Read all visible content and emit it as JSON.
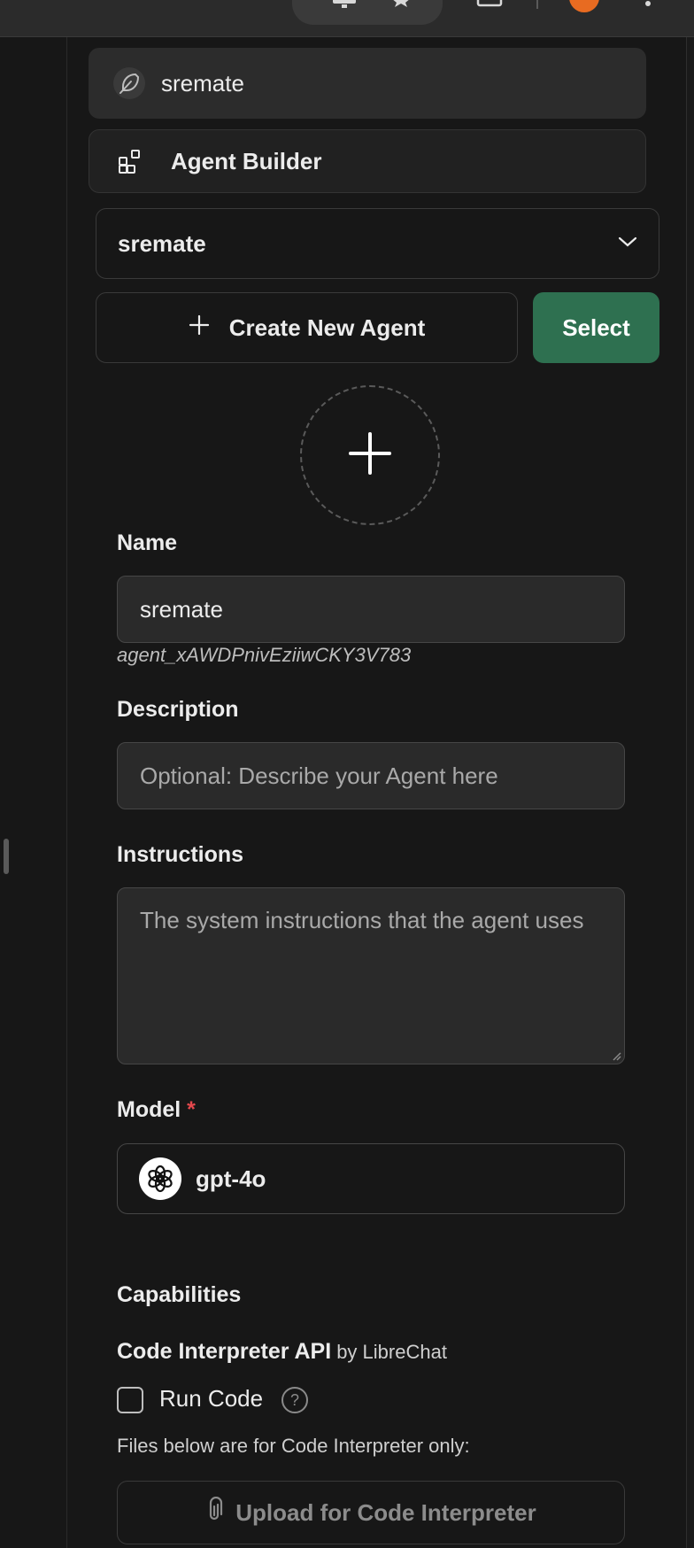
{
  "browser": {
    "icons": [
      "monitor-icon",
      "star-icon",
      "window-icon",
      "profile-avatar",
      "kebab-menu-icon"
    ],
    "accent": "#e86b21"
  },
  "side_panel": {
    "current_item": {
      "label": "sremate",
      "icon": "feather-icon"
    },
    "builder_item": {
      "label": "Agent Builder",
      "icon": "blocks-icon"
    },
    "agent_select": {
      "value": "sremate",
      "icon": "chevron-down-icon"
    },
    "create_button": "Create New Agent",
    "select_button": "Select",
    "select_color": "#2e7050"
  },
  "form": {
    "name": {
      "label": "Name",
      "value": "sremate",
      "agent_id": "agent_xAWDPnivEziiwCKY3V783"
    },
    "description": {
      "label": "Description",
      "placeholder": "Optional: Describe your Agent here"
    },
    "instructions": {
      "label": "Instructions",
      "placeholder": "The system instructions that the agent uses"
    },
    "model": {
      "label": "Model",
      "required_mark": "*",
      "value": "gpt-4o"
    },
    "capabilities": {
      "label": "Capabilities",
      "code_interpreter": {
        "title": "Code Interpreter API",
        "by": "by LibreChat",
        "run_code_label": "Run Code",
        "run_code_checked": false,
        "help_glyph": "?",
        "files_note": "Files below are for Code Interpreter only:",
        "upload_label": "Upload for Code Interpreter"
      }
    }
  }
}
